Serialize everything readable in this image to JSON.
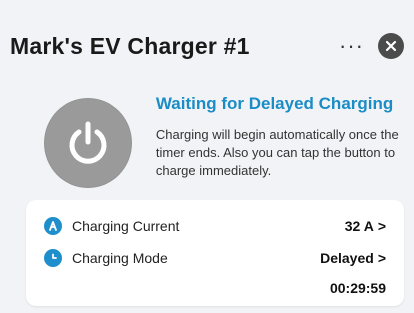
{
  "header": {
    "title": "Mark's EV Charger #1",
    "more_icon": "ellipsis-icon",
    "close_icon": "close-icon"
  },
  "status": {
    "title": "Waiting for Delayed Charging",
    "description": "Charging will begin automatically once the timer ends. Also you can tap the button to charge immediately.",
    "power_icon": "power-icon",
    "accent": "#1b8cc6",
    "button_color": "#9a9a9a"
  },
  "card": {
    "rows": [
      {
        "icon": "current-icon",
        "label": "Charging Current",
        "value": "32 A",
        "chevron": ">"
      },
      {
        "icon": "clock-icon",
        "label": "Charging Mode",
        "value": "Delayed",
        "chevron": ">"
      }
    ],
    "timer": "00:29:59"
  }
}
